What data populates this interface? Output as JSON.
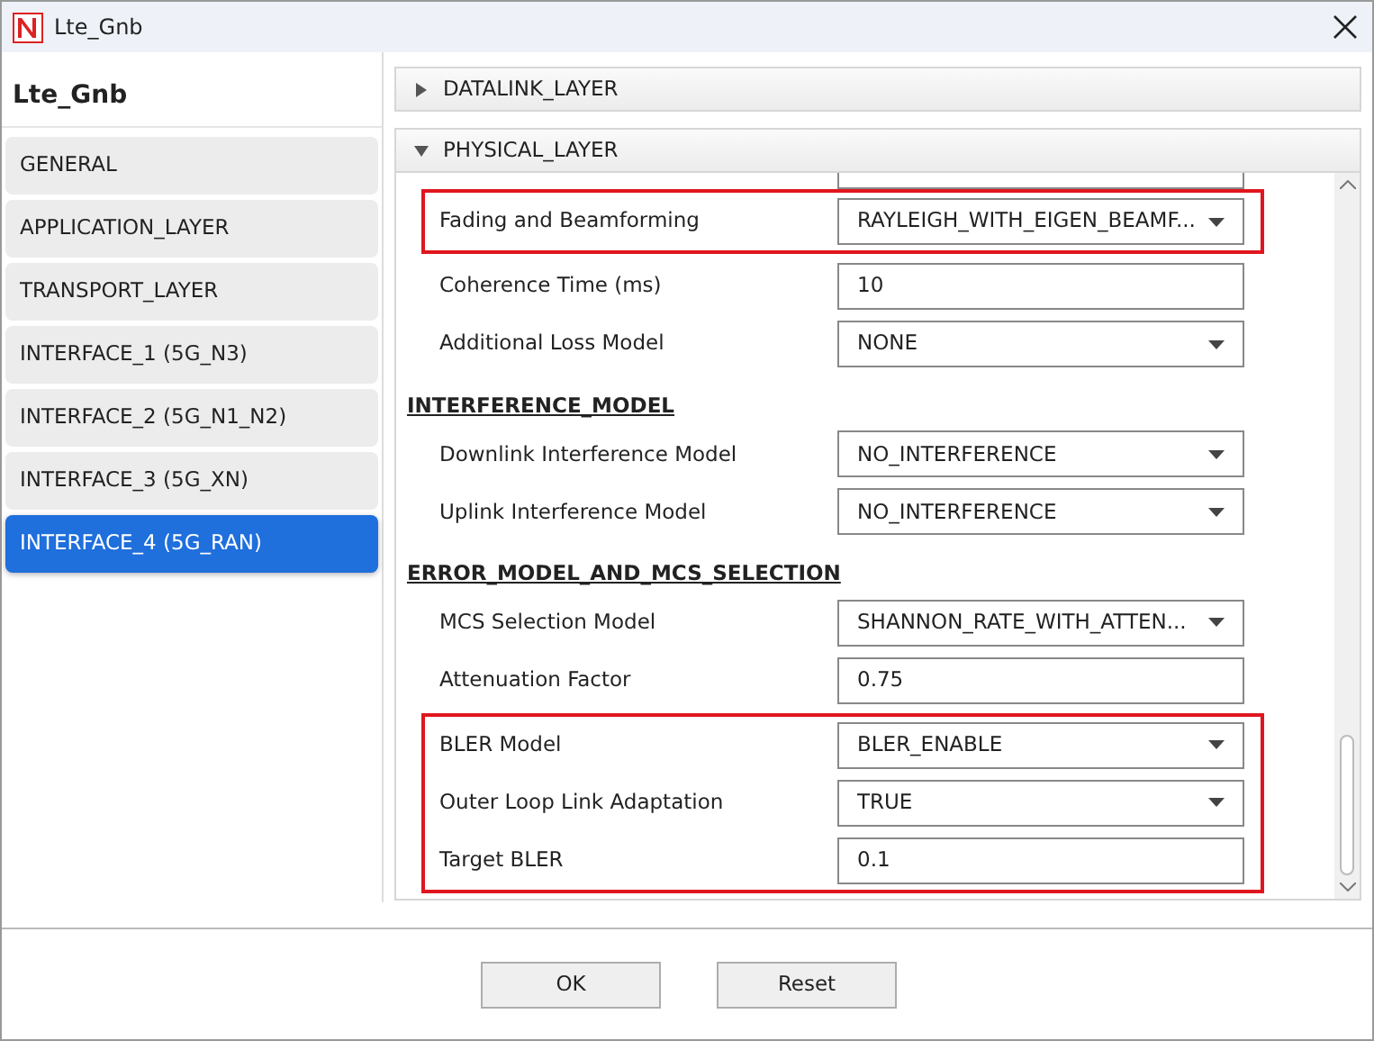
{
  "window": {
    "title": "Lte_Gnb"
  },
  "sidebar": {
    "title": "Lte_Gnb",
    "items": [
      {
        "label": "GENERAL",
        "selected": false
      },
      {
        "label": "APPLICATION_LAYER",
        "selected": false
      },
      {
        "label": "TRANSPORT_LAYER",
        "selected": false
      },
      {
        "label": "INTERFACE_1 (5G_N3)",
        "selected": false
      },
      {
        "label": "INTERFACE_2 (5G_N1_N2)",
        "selected": false
      },
      {
        "label": "INTERFACE_3 (5G_XN)",
        "selected": false
      },
      {
        "label": "INTERFACE_4 (5G_RAN)",
        "selected": true
      }
    ]
  },
  "panels": [
    {
      "title": "DATALINK_LAYER",
      "expanded": false
    },
    {
      "title": "PHYSICAL_LAYER",
      "expanded": true,
      "sections": [
        {
          "blocks": [
            {
              "highlighted": true,
              "rows": [
                {
                  "label": "Fading and Beamforming",
                  "kind": "select",
                  "value": "RAYLEIGH_WITH_EIGEN_BEAMF..."
                }
              ]
            },
            {
              "highlighted": false,
              "rows": [
                {
                  "label": "Coherence Time (ms)",
                  "kind": "text",
                  "value": "10"
                },
                {
                  "label": "Additional Loss Model",
                  "kind": "select",
                  "value": "NONE"
                }
              ]
            }
          ]
        },
        {
          "heading": "INTERFERENCE_MODEL",
          "blocks": [
            {
              "highlighted": false,
              "rows": [
                {
                  "label": "Downlink Interference Model",
                  "kind": "select",
                  "value": "NO_INTERFERENCE"
                },
                {
                  "label": "Uplink Interference Model",
                  "kind": "select",
                  "value": "NO_INTERFERENCE"
                }
              ]
            }
          ]
        },
        {
          "heading": "ERROR_MODEL_AND_MCS_SELECTION",
          "blocks": [
            {
              "highlighted": false,
              "rows": [
                {
                  "label": "MCS Selection Model",
                  "kind": "select",
                  "value": "SHANNON_RATE_WITH_ATTEN..."
                },
                {
                  "label": "Attenuation Factor",
                  "kind": "text",
                  "value": "0.75"
                }
              ]
            },
            {
              "highlighted": true,
              "rows": [
                {
                  "label": "BLER Model",
                  "kind": "select",
                  "value": "BLER_ENABLE"
                },
                {
                  "label": "Outer Loop Link Adaptation",
                  "kind": "select",
                  "value": "TRUE"
                },
                {
                  "label": "Target BLER",
                  "kind": "text",
                  "value": "0.1"
                }
              ]
            }
          ]
        }
      ]
    }
  ],
  "buttons": [
    "OK",
    "Reset"
  ]
}
